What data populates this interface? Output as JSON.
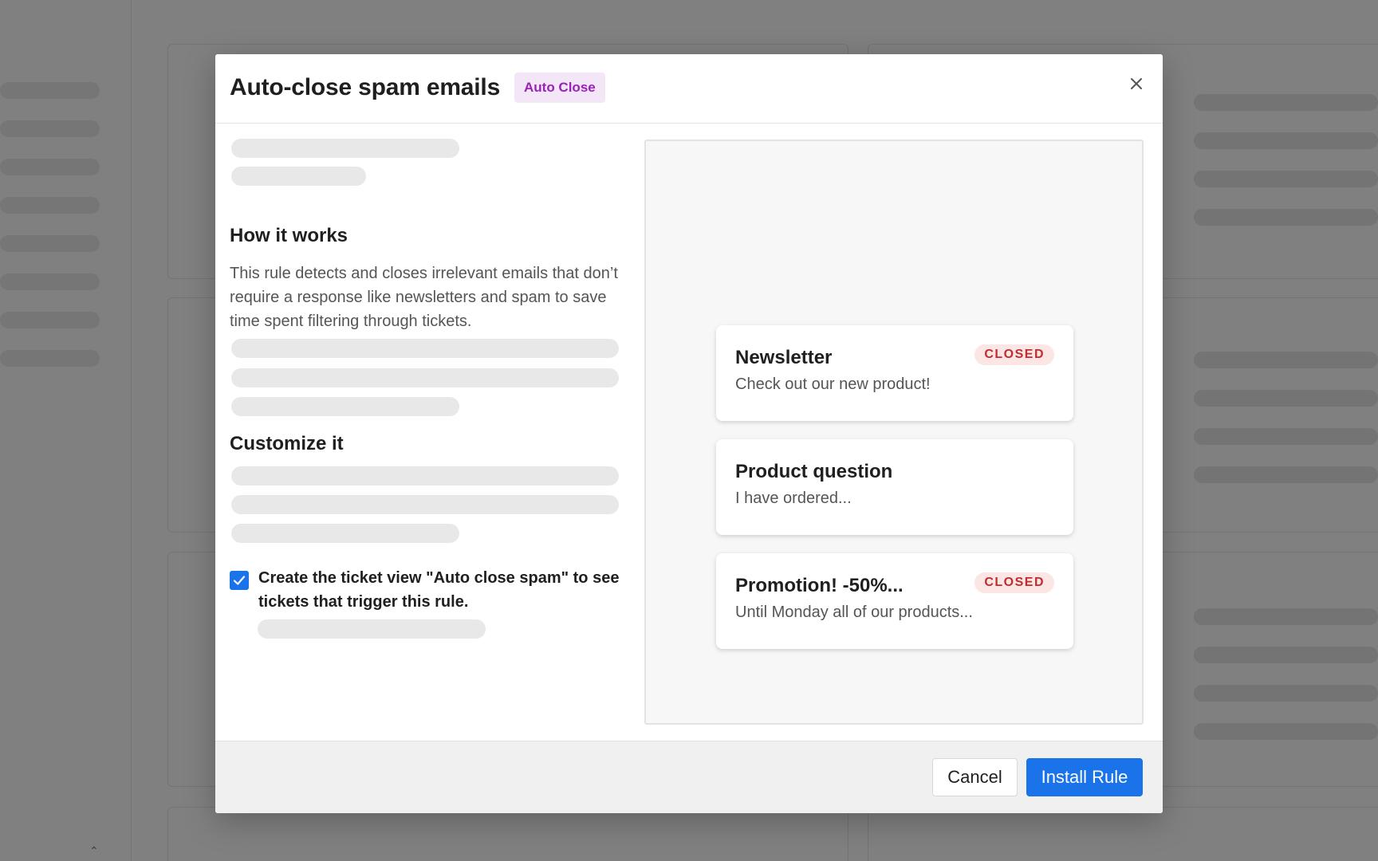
{
  "modal": {
    "title": "Auto-close spam emails",
    "tag": "Auto Close",
    "sections": {
      "how_it_works": {
        "title": "How it works",
        "body": "This rule detects and closes irrelevant emails that don’t require a response like newsletters and spam to save time spent filtering through tickets."
      },
      "customize": {
        "title": "Customize it"
      }
    },
    "checkbox": {
      "checked": true,
      "label": "Create the ticket view \"Auto close spam\" to see tickets that trigger this rule."
    },
    "preview": {
      "tickets": [
        {
          "title": "Newsletter",
          "snippet": "Check out our new product!",
          "badge": "CLOSED"
        },
        {
          "title": "Product question",
          "snippet": "I have ordered...",
          "badge": ""
        },
        {
          "title": "Promotion! -50%...",
          "snippet": "Until Monday all of our products...",
          "badge": "CLOSED"
        }
      ]
    },
    "footer": {
      "cancel_label": "Cancel",
      "install_label": "Install Rule"
    }
  },
  "icons": {
    "close": "close-icon",
    "check": "check-icon",
    "sidebar_collapse": "chevron-up-icon"
  },
  "colors": {
    "primary": "#1a73e8",
    "tag_background": "#f2e6f7",
    "tag_text": "#9a22b8",
    "closed_badge_background": "#fbe5e5",
    "closed_badge_text": "#c02d2d",
    "overlay": "#808080"
  }
}
